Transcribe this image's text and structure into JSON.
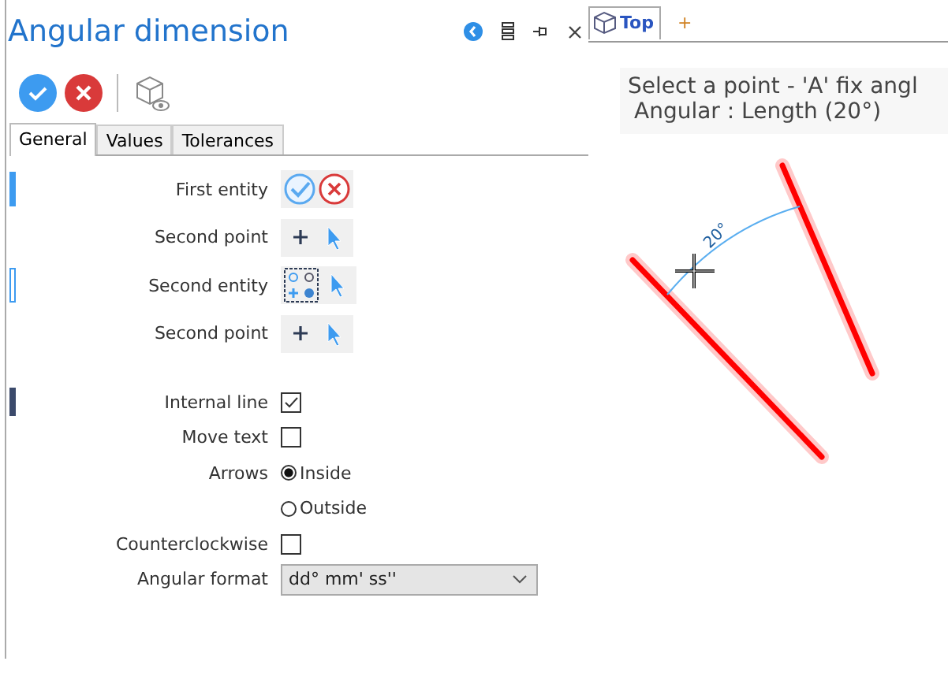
{
  "panel": {
    "title": "Angular dimension"
  },
  "tabs": [
    {
      "label": "General",
      "selected": true
    },
    {
      "label": "Values",
      "selected": false
    },
    {
      "label": "Tolerances",
      "selected": false
    }
  ],
  "entity_rows": [
    {
      "label": "First entity",
      "kind": "confirm",
      "active": true
    },
    {
      "label": "Second point",
      "kind": "point"
    },
    {
      "label": "Second entity",
      "kind": "entity",
      "active": false
    },
    {
      "label": "Second point",
      "kind": "point"
    }
  ],
  "options": [
    {
      "label": "Internal line",
      "kind": "checkbox",
      "checked": true,
      "section_marker": true
    },
    {
      "label": "Move text",
      "kind": "checkbox",
      "checked": false
    },
    {
      "label": "Arrows",
      "kind": "radio",
      "choices": [
        {
          "label": "Inside",
          "selected": true
        },
        {
          "label": "Outside",
          "selected": false
        }
      ]
    },
    {
      "label": "Counterclockwise",
      "kind": "checkbox",
      "checked": false
    },
    {
      "label": "Angular format",
      "kind": "select",
      "value": "dd° mm' ss''"
    }
  ],
  "viewport": {
    "tabs": [
      {
        "label": "Top"
      }
    ],
    "add_tab": "+",
    "message": [
      "Select a point - 'A' fix angl",
      "Angular : Length (20°)"
    ],
    "dimension_value": "20°"
  }
}
